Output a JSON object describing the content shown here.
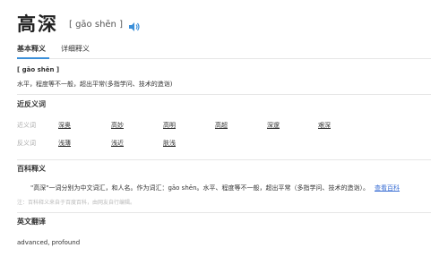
{
  "header": {
    "word": "高深",
    "pinyin": "[ gāo shēn ]"
  },
  "tabs": [
    {
      "label": "基本释义"
    },
    {
      "label": "详细释义"
    }
  ],
  "basic": {
    "pinyin": "[ gāo shēn ]",
    "definition": "水平，程度等不一般，超出平常(多指学问、技术的造诣)"
  },
  "related": {
    "title": "近反义词",
    "synonym_label": "近义词",
    "synonyms": [
      "深奥",
      "高妙",
      "高明",
      "高超",
      "深邃",
      "艰深"
    ],
    "antonym_label": "反义词",
    "antonyms": [
      "浅薄",
      "浅近",
      "肤浅"
    ]
  },
  "baike": {
    "title": "百科释义",
    "text": "\"高深\"一词分别为中文词汇，和人名。作为词汇：gāo shēn。水平、程度等不一般，超出平常（多指学问、技术的造诣）。",
    "link_label": "查看百科",
    "note": "注：百科释义来自于百度百科，由网友自行编辑。"
  },
  "english": {
    "title": "英文翻译",
    "text": "advanced, profound"
  },
  "colors": {
    "accent": "#3b8fd9",
    "link": "#3b6fd4"
  },
  "icons": {
    "sound": "speaker-icon"
  }
}
